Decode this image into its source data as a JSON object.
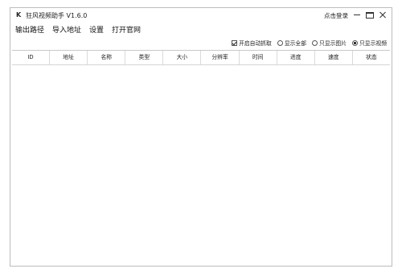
{
  "titlebar": {
    "icon_glyph": "K",
    "title": "狂风视频助手 V1.6.0",
    "login": "点击登录"
  },
  "menu": {
    "items": [
      "输出路径",
      "导入地址",
      "设置",
      "打开官网"
    ]
  },
  "options": {
    "auto_capture": {
      "label": "开启自动抓取",
      "checked": true
    },
    "show_all": {
      "label": "显示全部",
      "selected": false
    },
    "only_images": {
      "label": "只显示图片",
      "selected": false
    },
    "only_videos": {
      "label": "只显示视频",
      "selected": true
    }
  },
  "table": {
    "columns": [
      "ID",
      "地址",
      "名称",
      "类型",
      "大小",
      "分辨率",
      "时间",
      "进度",
      "速度",
      "状态"
    ],
    "rows": []
  }
}
